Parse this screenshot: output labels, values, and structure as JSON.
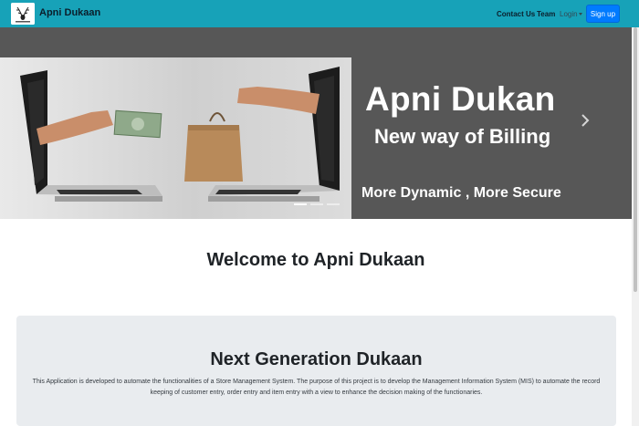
{
  "navbar": {
    "brand_name": "Apni Dukaan",
    "logo_icon": "stag-logo-icon",
    "links": {
      "contact": "Contact Us",
      "team": "Team",
      "login": "Login"
    },
    "signup_label": "Sign up",
    "background_color": "#17a2b8"
  },
  "carousel": {
    "title": "Apni Dukan",
    "subtitle": "New way of Billing",
    "tagline": "More Dynamic , More Secure",
    "next_icon": "chevron-right-icon",
    "slide_count": 3,
    "active_slide": 1,
    "background_color": "#575757"
  },
  "main": {
    "welcome_heading": "Welcome to Apni Dukaan"
  },
  "jumbotron": {
    "title": "Next Generation Dukaan",
    "description": "This Application is developed to automate the functionalities of a Store Management System. The purpose of this project is to develop the Management Information System (MIS) to automate the record keeping of customer entry, order entry and item entry with a view to enhance the decision making of the functionaries."
  }
}
